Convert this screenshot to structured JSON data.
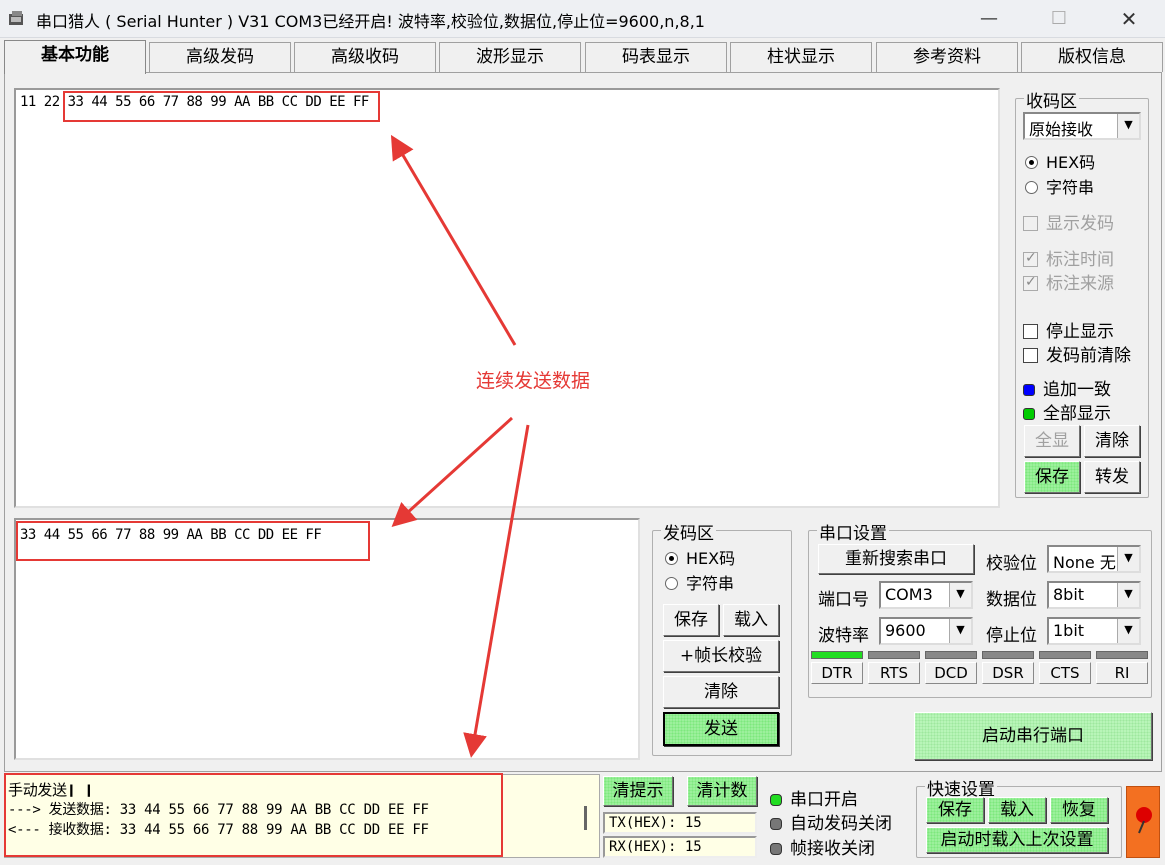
{
  "window": {
    "title": "串口猎人 ( Serial Hunter ) V31     COM3已经开启!   波特率,校验位,数据位,停止位=9600,n,8,1",
    "minimize_label": "—",
    "maximize_label": "☐",
    "close_label": "✕"
  },
  "tabs": [
    {
      "label": "基本功能"
    },
    {
      "label": "高级发码"
    },
    {
      "label": "高级收码"
    },
    {
      "label": "波形显示"
    },
    {
      "label": "码表显示"
    },
    {
      "label": "柱状显示"
    },
    {
      "label": "参考资料"
    },
    {
      "label": "版权信息"
    }
  ],
  "receive": {
    "text": "11 22 33 44 55 66 77 88 99 AA BB CC DD EE FF"
  },
  "send": {
    "text": "33 44 55 66 77 88 99 AA BB CC DD EE FF"
  },
  "recv_panel": {
    "title": "收码区",
    "mode_select": "原始接收",
    "radio_hex": "HEX码",
    "radio_string": "字符串",
    "show_send": "显示发码",
    "mark_time": "标注时间",
    "mark_source": "标注来源",
    "stop_display": "停止显示",
    "clear_before_send": "发码前清除",
    "append_same": "追加一致",
    "show_all": "全部显示",
    "btn_show_all": "全显",
    "btn_clear": "清除",
    "btn_save": "保存",
    "btn_forward": "转发",
    "led_blue": "#0000ff",
    "led_green": "#00cc00"
  },
  "send_panel": {
    "title": "发码区",
    "radio_hex": "HEX码",
    "radio_string": "字符串",
    "btn_save": "保存",
    "btn_load": "载入",
    "btn_frame_check": "+帧长校验",
    "btn_clear": "清除",
    "btn_send": "发送"
  },
  "serial": {
    "title": "串口设置",
    "btn_rescan": "重新搜索串口",
    "parity_label": "校验位",
    "parity_value": "None 无",
    "port_label": "端口号",
    "port_value": "COM3",
    "databits_label": "数据位",
    "databits_value": "8bit",
    "baud_label": "波特率",
    "baud_value": "9600",
    "stopbits_label": "停止位",
    "stopbits_value": "1bit",
    "signals": [
      {
        "name": "DTR",
        "on": true
      },
      {
        "name": "RTS",
        "on": false
      },
      {
        "name": "DCD",
        "on": false
      },
      {
        "name": "DSR",
        "on": false
      },
      {
        "name": "CTS",
        "on": false
      },
      {
        "name": "RI",
        "on": false
      }
    ],
    "btn_start": "启动串行端口"
  },
  "status": {
    "line1": "手动发送❙ ❙",
    "line2": "---> 发送数据: 33 44 55 66 77 88 99 AA BB CC DD EE FF",
    "line3": "<--- 接收数据: 33 44 55 66 77 88 99 AA BB CC DD EE FF",
    "btn_clear_tips": "清提示",
    "btn_clear_count": "清计数",
    "tx_label": "TX(HEX): 15",
    "rx_label": "RX(HEX): 15",
    "port_open": "串口开启",
    "auto_send_off": "自动发码关闭",
    "frame_recv_off": "帧接收关闭"
  },
  "quick": {
    "title": "快速设置",
    "btn_save": "保存",
    "btn_load": "载入",
    "btn_restore": "恢复",
    "btn_load_last": "启动时载入上次设置"
  },
  "annotation": {
    "label": "连续发送数据",
    "color": "#e53935"
  }
}
